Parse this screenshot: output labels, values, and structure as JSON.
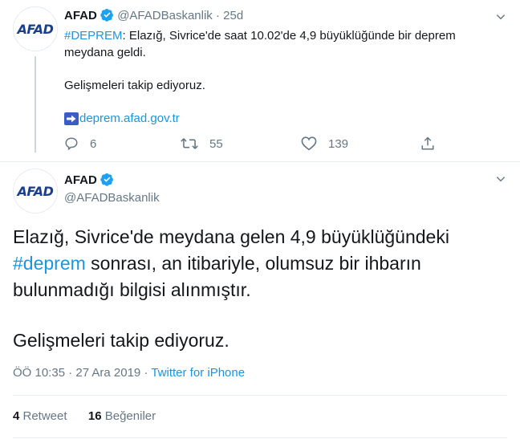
{
  "tweet1": {
    "name": "AFAD",
    "handle": "@AFADBaskanlik",
    "separator": "·",
    "time": "25d",
    "hashtag": "#DEPREM",
    "text_rest": ": Elazığ, Sivrice'de saat 10.02'de 4,9 büyüklüğünde bir deprem",
    "text_line2": "meydana geldi.",
    "text_para2": "Gelişmeleri takip ediyoruz.",
    "link_text": "deprem.afad.gov.tr",
    "replies": "6",
    "retweets": "55",
    "likes": "139"
  },
  "tweet2": {
    "name": "AFAD",
    "handle": "@AFADBaskanlik",
    "line1": "Elazığ, Sivrice'de meydana gelen 4,9 büyüklüğündeki",
    "hashtag": "#deprem",
    "line2_rest": " sonrası, an itibariyle, olumsuz bir ihbarın",
    "line3": "bulunmadığı bilgisi alınmıştır.",
    "para2": "Gelişmeleri takip ediyoruz.",
    "meta_time": "ÖÖ 10:35 · 27 Ara 2019 · ",
    "meta_source": "Twitter for iPhone",
    "retweet_count": "4",
    "retweet_label": " Retweet",
    "like_count": "16",
    "like_label": " Beğeniler"
  },
  "avatar_text": "AFAD",
  "colors": {
    "link": "#1b95e0",
    "muted": "#657786",
    "brand": "#1b3f8f",
    "arrow_badge": "#3b5cc4"
  },
  "icons": [
    "verified-badge-icon",
    "chevron-down-icon",
    "reply-icon",
    "retweet-icon",
    "like-icon",
    "share-icon",
    "arrow-right-icon"
  ]
}
